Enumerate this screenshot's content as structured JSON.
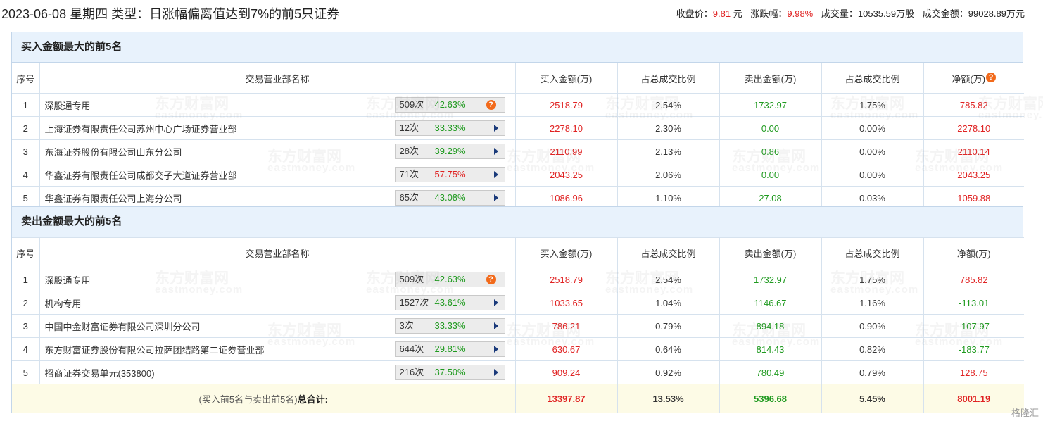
{
  "header": {
    "title": "2023-06-08 星期四 类型：日涨幅偏离值达到7%的前5只证券",
    "close_label": "收盘价：",
    "close_value": "9.81",
    "close_unit": "元",
    "change_label": "涨跌幅：",
    "change_value": "9.98%",
    "volume_label": "成交量：",
    "volume_value": "10535.59万股",
    "amount_label": "成交金额：",
    "amount_value": "99028.89万元"
  },
  "columns": [
    "序号",
    "交易营业部名称",
    "买入金额(万)",
    "占总成交比例",
    "卖出金额(万)",
    "占总成交比例",
    "净额(万)"
  ],
  "buy_section": {
    "title": "买入金额最大的前5名",
    "rows": [
      {
        "idx": "1",
        "name": "深股通专用",
        "count": "509次",
        "pct": "42.63%",
        "pct_color": "green",
        "icon": "question",
        "buy": "2518.79",
        "buy_ratio": "2.54%",
        "sell": "1732.97",
        "sell_ratio": "1.75%",
        "net": "785.82",
        "net_color": "red"
      },
      {
        "idx": "2",
        "name": "上海证券有限责任公司苏州中心广场证券营业部",
        "count": "12次",
        "pct": "33.33%",
        "pct_color": "green",
        "icon": "arrow",
        "buy": "2278.10",
        "buy_ratio": "2.30%",
        "sell": "0.00",
        "sell_ratio": "0.00%",
        "net": "2278.10",
        "net_color": "red"
      },
      {
        "idx": "3",
        "name": "东海证券股份有限公司山东分公司",
        "count": "28次",
        "pct": "39.29%",
        "pct_color": "green",
        "icon": "arrow",
        "buy": "2110.99",
        "buy_ratio": "2.13%",
        "sell": "0.86",
        "sell_ratio": "0.00%",
        "net": "2110.14",
        "net_color": "red"
      },
      {
        "idx": "4",
        "name": "华鑫证券有限责任公司成都交子大道证券营业部",
        "count": "71次",
        "pct": "57.75%",
        "pct_color": "red",
        "icon": "arrow",
        "buy": "2043.25",
        "buy_ratio": "2.06%",
        "sell": "0.00",
        "sell_ratio": "0.00%",
        "net": "2043.25",
        "net_color": "red"
      },
      {
        "idx": "5",
        "name": "华鑫证券有限责任公司上海分公司",
        "count": "65次",
        "pct": "43.08%",
        "pct_color": "green",
        "icon": "arrow",
        "buy": "1086.96",
        "buy_ratio": "1.10%",
        "sell": "27.08",
        "sell_ratio": "0.03%",
        "net": "1059.88",
        "net_color": "red"
      }
    ]
  },
  "sell_section": {
    "title": "卖出金额最大的前5名",
    "rows": [
      {
        "idx": "1",
        "name": "深股通专用",
        "count": "509次",
        "pct": "42.63%",
        "pct_color": "green",
        "icon": "question",
        "buy": "2518.79",
        "buy_ratio": "2.54%",
        "sell": "1732.97",
        "sell_ratio": "1.75%",
        "net": "785.82",
        "net_color": "red"
      },
      {
        "idx": "2",
        "name": "机构专用",
        "count": "1527次",
        "pct": "43.61%",
        "pct_color": "green",
        "icon": "arrow",
        "buy": "1033.65",
        "buy_ratio": "1.04%",
        "sell": "1146.67",
        "sell_ratio": "1.16%",
        "net": "-113.01",
        "net_color": "green"
      },
      {
        "idx": "3",
        "name": "中国中金财富证券有限公司深圳分公司",
        "count": "3次",
        "pct": "33.33%",
        "pct_color": "green",
        "icon": "arrow",
        "buy": "786.21",
        "buy_ratio": "0.79%",
        "sell": "894.18",
        "sell_ratio": "0.90%",
        "net": "-107.97",
        "net_color": "green"
      },
      {
        "idx": "4",
        "name": "东方财富证券股份有限公司拉萨团结路第二证券营业部",
        "count": "644次",
        "pct": "29.81%",
        "pct_color": "green",
        "icon": "arrow",
        "buy": "630.67",
        "buy_ratio": "0.64%",
        "sell": "814.43",
        "sell_ratio": "0.82%",
        "net": "-183.77",
        "net_color": "green"
      },
      {
        "idx": "5",
        "name": "招商证券交易单元(353800)",
        "count": "216次",
        "pct": "37.50%",
        "pct_color": "green",
        "icon": "arrow",
        "buy": "909.24",
        "buy_ratio": "0.92%",
        "sell": "780.49",
        "sell_ratio": "0.79%",
        "net": "128.75",
        "net_color": "red"
      }
    ]
  },
  "total": {
    "label_prefix": "(买入前5名与卖出前5名)",
    "label_bold": "总合计:",
    "buy": "13397.87",
    "buy_ratio": "13.53%",
    "sell": "5396.68",
    "sell_ratio": "5.45%",
    "net": "8001.19"
  },
  "watermark": {
    "cn": "东方财富网",
    "en": "eastmoney.com"
  },
  "corner_logo": "格隆汇",
  "colors": {
    "up": "#e02222",
    "down": "#1f9a1f",
    "header_bg": "#e8f2fc",
    "total_bg": "#fdfbe6",
    "border": "#c3d6ea"
  }
}
